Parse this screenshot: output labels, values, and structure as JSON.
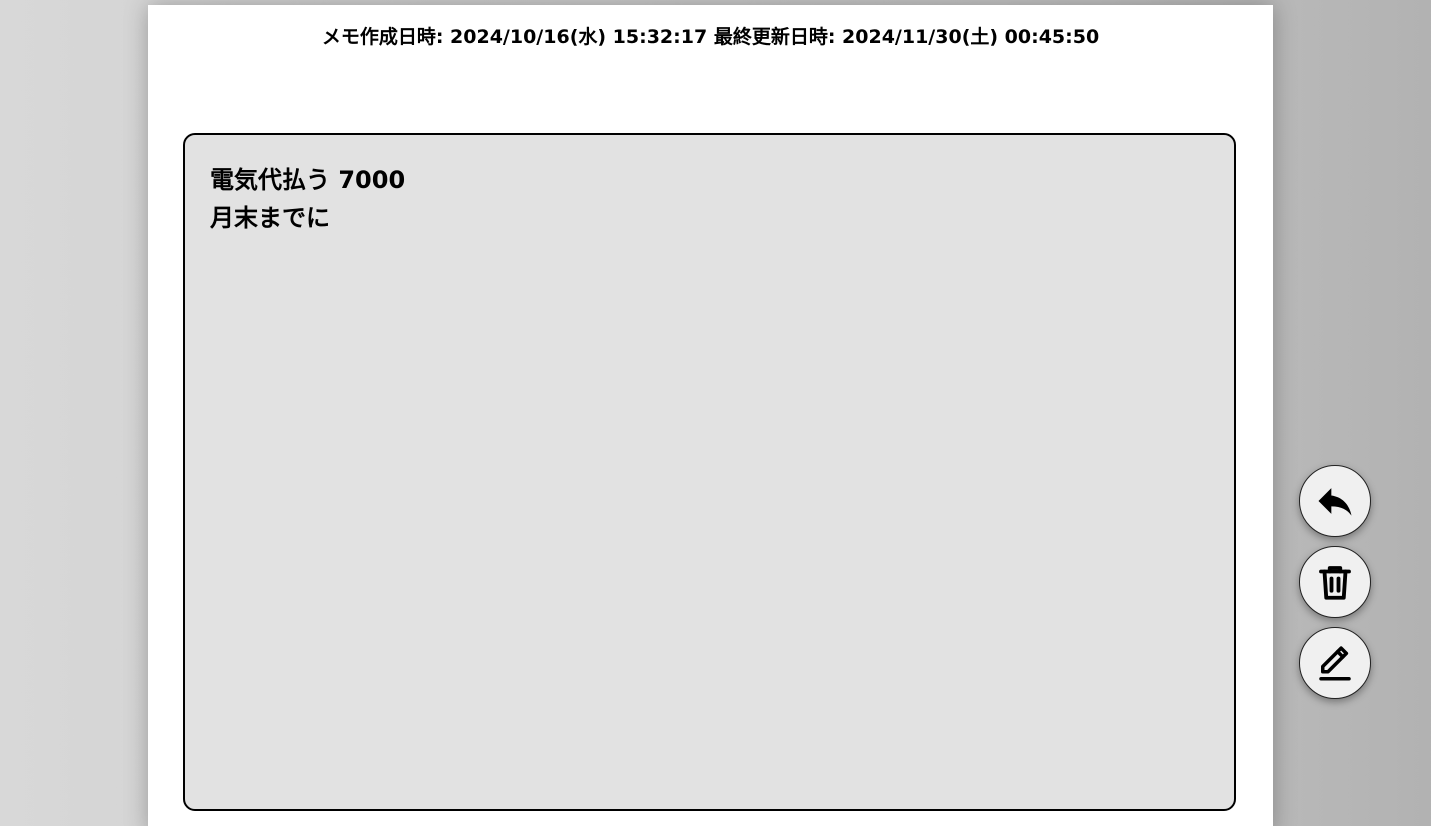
{
  "meta": {
    "created_label": "メモ作成日時:",
    "created_value": "2024/10/16(水) 15:32:17",
    "updated_label": "最終更新日時:",
    "updated_value": "2024/11/30(土) 00:45:50"
  },
  "memo": {
    "lines": [
      "電気代払う 7000",
      "月末までに"
    ]
  },
  "actions": {
    "back_icon": "reply-arrow-icon",
    "delete_icon": "trash-icon",
    "edit_icon": "pencil-edit-icon"
  }
}
